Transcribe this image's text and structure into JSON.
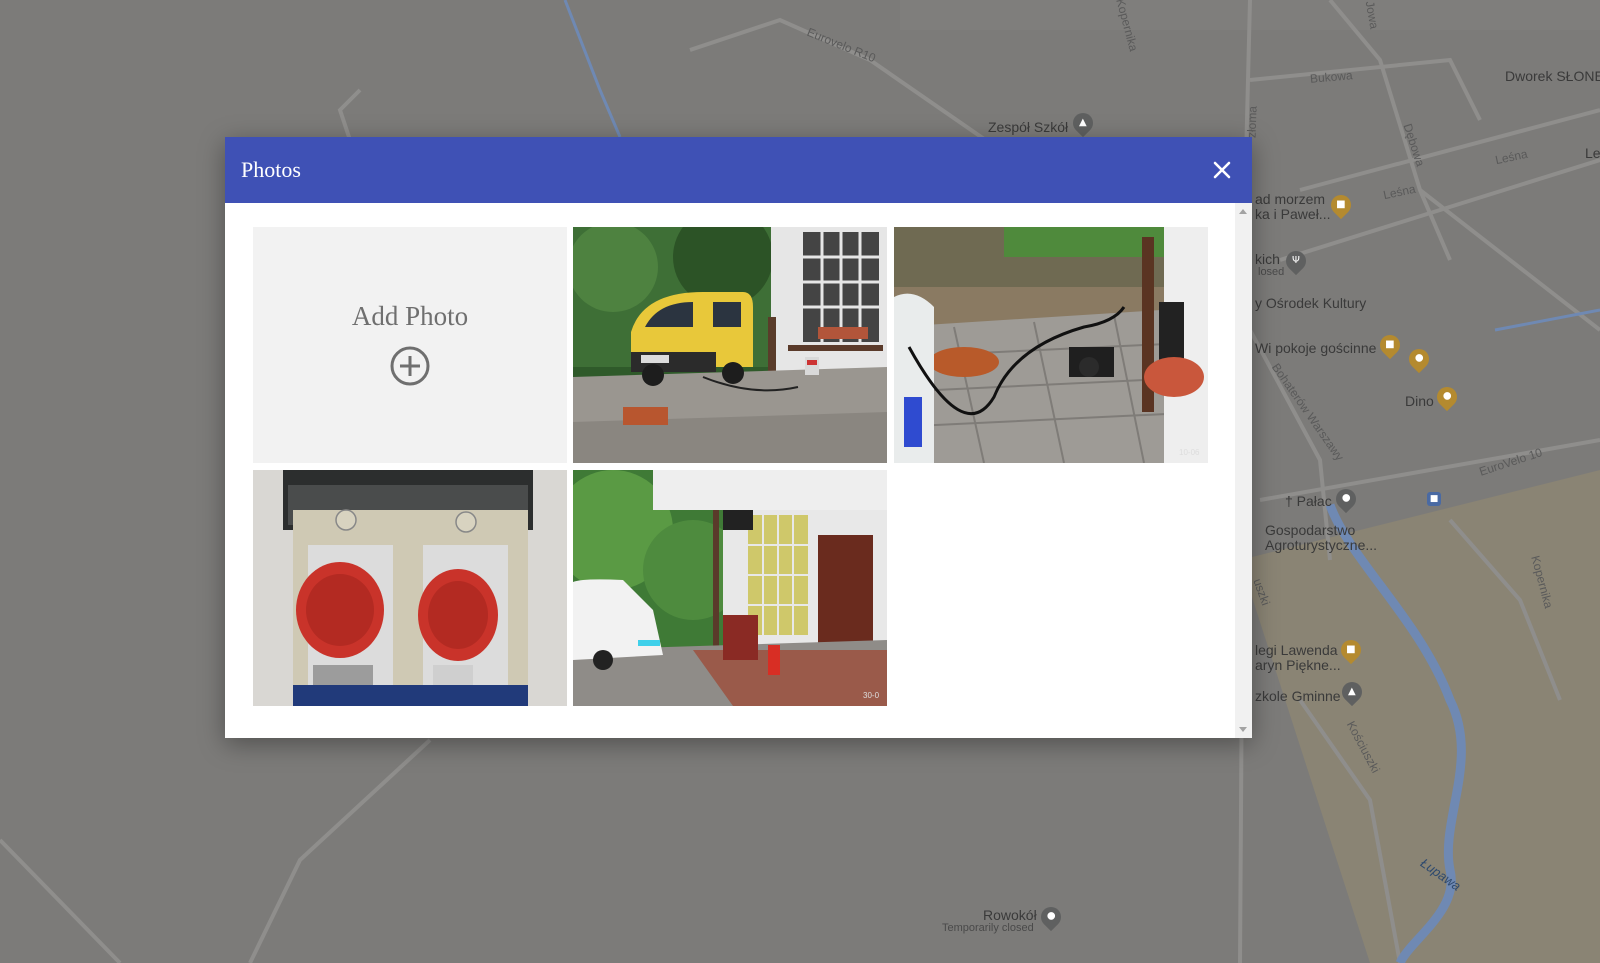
{
  "map": {
    "labels": {
      "eurovelo_r10": "Eurovelo R10",
      "kopernika_top": "Kopernika",
      "jowa": "Jowa",
      "bukowa": "Bukowa",
      "dworek": "Dworek SŁONE",
      "zespol_szkol": "Zespół Szkół",
      "lesna_1": "Leśna",
      "lesna_2": "Leśna",
      "le": "Le",
      "debowa": "Dębowa",
      "zloma": "złoma",
      "morzem": "ad morzem",
      "pawel": "ka i Paweł...",
      "kich": "kich",
      "kich_closed": "losed",
      "osrodek": "y Ośrodek Kultury",
      "pokoje": "Wi pokoje gościnne",
      "dino": "Dino",
      "bohaterow": "Bohaterów Warszawy",
      "eurovelo_10": "EuroVelo 10",
      "palac": "† Pałac",
      "gospodarstwo": "Gospodarstwo",
      "agroturystyczne": "Agroturystyczne...",
      "kopernika_right": "Kopernika",
      "uszki": "uszki",
      "lawenda": "legi Lawenda",
      "piekne": "aryn Piękne...",
      "szkole": "zkole Gminne",
      "kosciuszki": "Kościuszki",
      "lupawa": "Łupawa",
      "rowokol": "Rowokół",
      "temporarily_closed": "Temporarily closed"
    }
  },
  "dialog": {
    "title": "Photos",
    "close_icon": "close-icon",
    "add_photo_label": "Add Photo",
    "add_icon": "plus-circle-icon",
    "photos": [
      {
        "subject": "yellow van charging"
      },
      {
        "subject": "charging cable on pavement",
        "stamp": "10-06"
      },
      {
        "subject": "red power sockets"
      },
      {
        "subject": "white car at building",
        "stamp": "30-0"
      }
    ]
  },
  "colors": {
    "header": "#3f51b5",
    "add_tile_bg": "#f2f2f2",
    "map_bg": "#7c7b79"
  }
}
